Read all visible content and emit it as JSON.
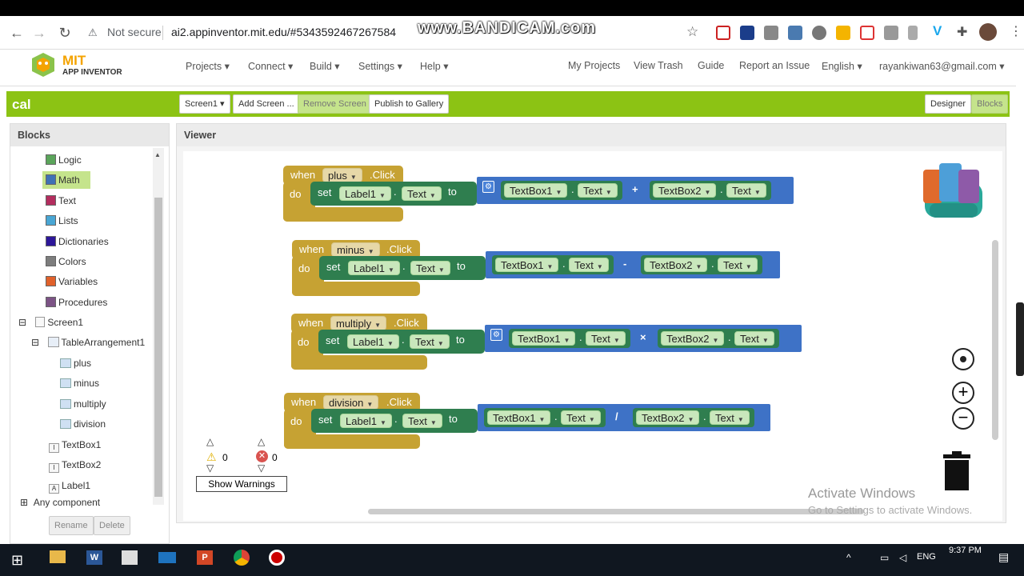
{
  "browser": {
    "secure_label": "Not secure",
    "url": "ai2.appinventor.mit.edu/#5343592467267584",
    "watermark": "www.BANDICAM.com"
  },
  "logo": {
    "line1": "MIT",
    "line2": "APP INVENTOR"
  },
  "menu": {
    "left": [
      "Projects",
      "Connect",
      "Build",
      "Settings",
      "Help"
    ],
    "right": [
      "My Projects",
      "View Trash",
      "Guide",
      "Report an Issue",
      "English"
    ],
    "user": "rayankiwan63@gmail.com"
  },
  "project": {
    "name": "cal",
    "screen": "Screen1",
    "add_screen": "Add Screen ...",
    "remove_screen": "Remove Screen",
    "publish": "Publish to Gallery",
    "designer": "Designer",
    "blocks": "Blocks"
  },
  "blocks_panel": {
    "title": "Blocks",
    "builtin": [
      {
        "label": "Logic",
        "color": "#5ba55b"
      },
      {
        "label": "Math",
        "color": "#3f71b5"
      },
      {
        "label": "Text",
        "color": "#b32d5e"
      },
      {
        "label": "Lists",
        "color": "#49a6d4"
      },
      {
        "label": "Dictionaries",
        "color": "#2d1799"
      },
      {
        "label": "Colors",
        "color": "#7d7d7d"
      },
      {
        "label": "Variables",
        "color": "#e0612b"
      },
      {
        "label": "Procedures",
        "color": "#7c5385"
      }
    ],
    "tree": {
      "screen": "Screen1",
      "arrangement": "TableArrangement1",
      "buttons": [
        "plus",
        "minus",
        "multiply",
        "division"
      ],
      "others": [
        "TextBox1",
        "TextBox2",
        "Label1"
      ]
    },
    "any_component": "Any component",
    "rename": "Rename",
    "delete": "Delete"
  },
  "viewer": {
    "title": "Viewer"
  },
  "events": [
    {
      "button": "plus",
      "op": "+"
    },
    {
      "button": "minus",
      "op": "-"
    },
    {
      "button": "multiply",
      "op": "×"
    },
    {
      "button": "division",
      "op": "/"
    }
  ],
  "block_words": {
    "when": "when",
    "click": ".Click",
    "do": "do",
    "set": "set",
    "label": "Label1",
    "text_prop": "Text",
    "to": "to",
    "tb1": "TextBox1",
    "tb2": "TextBox2",
    "dot": "."
  },
  "warnings": {
    "warn_count": "0",
    "error_count": "0",
    "show_button": "Show Warnings"
  },
  "activate": {
    "line1": "Activate Windows",
    "line2": "Go to Settings to activate Windows."
  },
  "taskbar": {
    "time": "9:37 PM",
    "lang": "ENG"
  }
}
